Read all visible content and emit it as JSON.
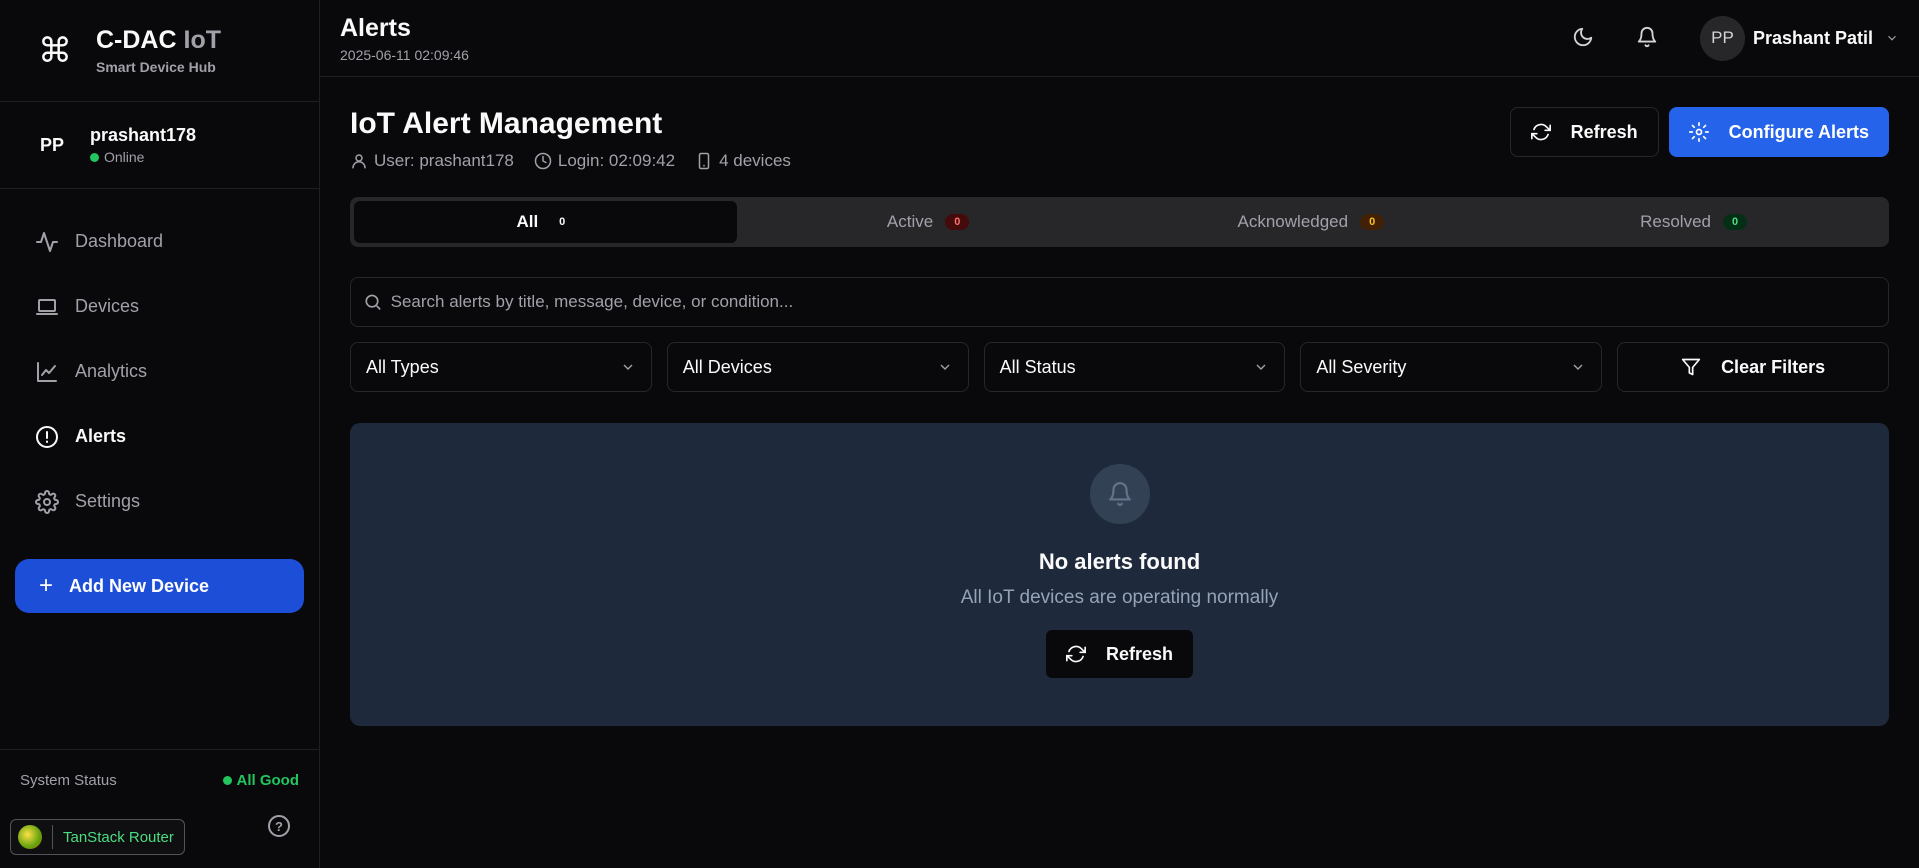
{
  "brand": {
    "title_main": "C-DAC",
    "title_accent": "IoT",
    "subtitle": "Smart Device Hub",
    "icon": "command-icon"
  },
  "sidebar_user": {
    "initials": "PP",
    "name": "prashant178",
    "status": "Online"
  },
  "nav": [
    {
      "label": "Dashboard",
      "icon": "activity-icon"
    },
    {
      "label": "Devices",
      "icon": "laptop-icon"
    },
    {
      "label": "Analytics",
      "icon": "line-chart-icon"
    },
    {
      "label": "Alerts",
      "icon": "alert-circle-icon",
      "active": true
    },
    {
      "label": "Settings",
      "icon": "gear-icon"
    }
  ],
  "add_device_label": "Add New Device",
  "system_status": {
    "label": "System Status",
    "value": "All Good"
  },
  "devtools_label": "TanStack Router",
  "header": {
    "title": "Alerts",
    "timestamp": "2025-06-11 02:09:46",
    "user_initials": "PP",
    "user_name": "Prashant Patil"
  },
  "page": {
    "title": "IoT Alert Management",
    "user_meta": "User: prashant178",
    "login_meta": "Login: 02:09:42",
    "devices_meta": "4 devices",
    "refresh_label": "Refresh",
    "configure_label": "Configure Alerts"
  },
  "tabs": [
    {
      "label": "All",
      "count": "0"
    },
    {
      "label": "Active",
      "count": "0"
    },
    {
      "label": "Acknowledged",
      "count": "0"
    },
    {
      "label": "Resolved",
      "count": "0"
    }
  ],
  "search": {
    "placeholder": "Search alerts by title, message, device, or condition..."
  },
  "filters": {
    "types": "All Types",
    "devices": "All Devices",
    "status": "All Status",
    "severity": "All Severity",
    "clear": "Clear Filters"
  },
  "empty": {
    "title": "No alerts found",
    "subtitle": "All IoT devices are operating normally",
    "refresh": "Refresh"
  },
  "colors": {
    "primary": "#2563eb",
    "add_button": "#1d4ed8",
    "success": "#22c55e",
    "panel": "#1e293b",
    "background": "#09090b"
  }
}
